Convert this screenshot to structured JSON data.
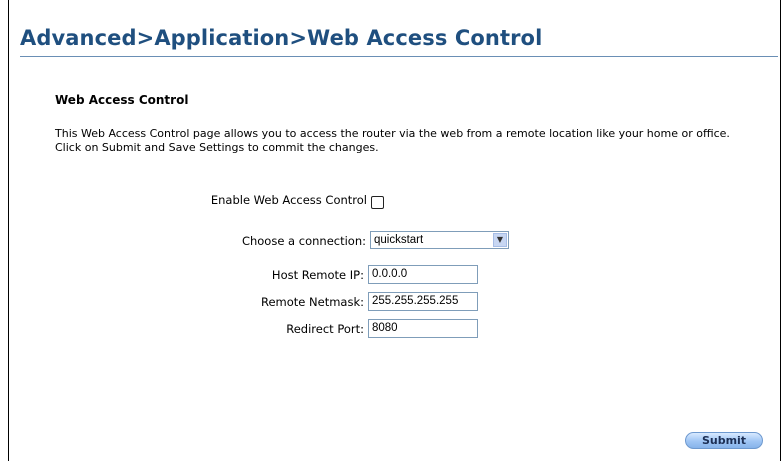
{
  "page": {
    "title": "Advanced>Application>Web Access Control",
    "section_heading": "Web Access Control",
    "description_line1": "This Web Access Control page allows you to access the router via the web from a remote location like your home or office.",
    "description_line2": "Click on Submit and Save Settings to commit the changes."
  },
  "form": {
    "enable_label": "Enable Web Access Control",
    "enable_checked": false,
    "connection_label": "Choose a connection:",
    "connection_value": "quickstart",
    "host_ip_label": "Host Remote IP:",
    "host_ip_value": "0.0.0.0",
    "netmask_label": "Remote Netmask:",
    "netmask_value": "255.255.255.255",
    "port_label": "Redirect Port:",
    "port_value": "8080"
  },
  "actions": {
    "submit_label": "Submit"
  }
}
